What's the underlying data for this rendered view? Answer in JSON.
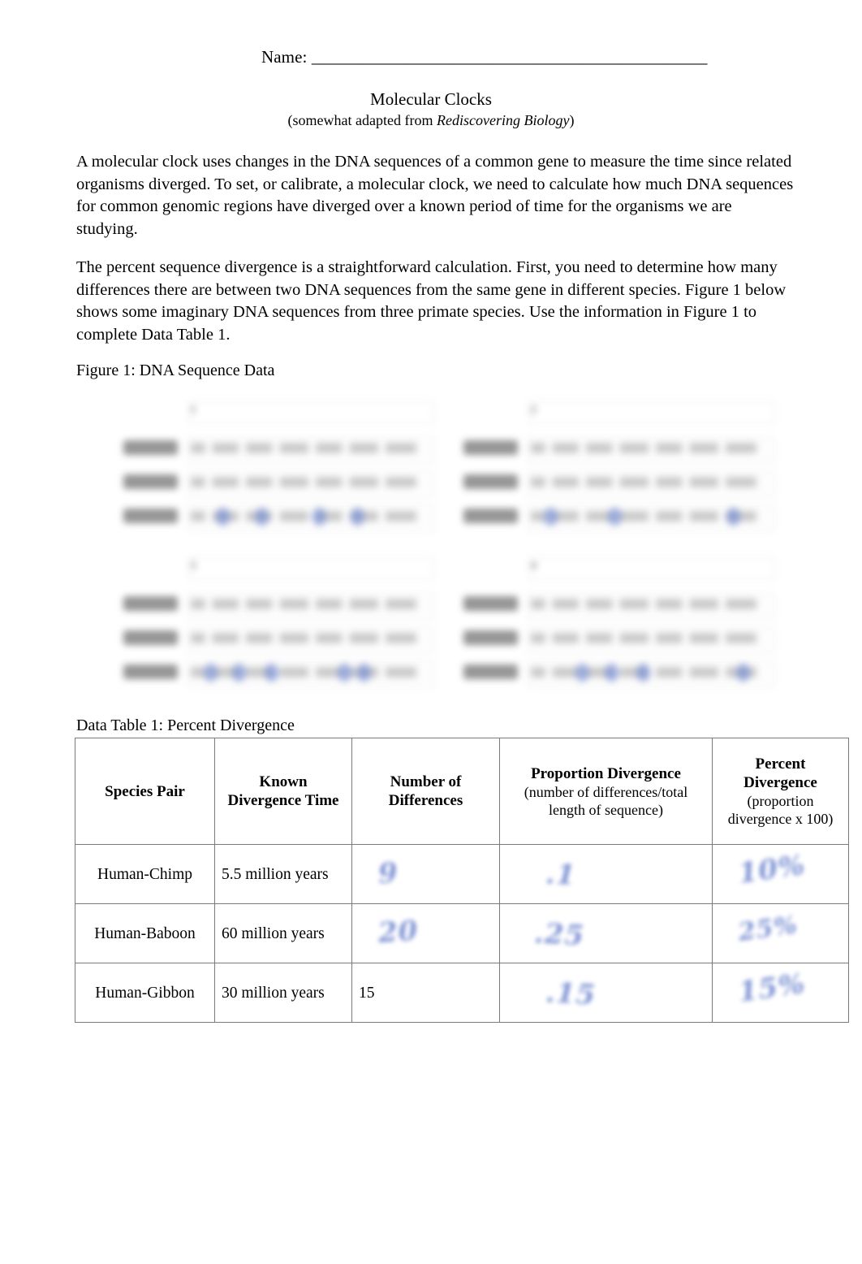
{
  "document": {
    "name_label": "Name: ______________________________________________",
    "title": "Molecular Clocks",
    "subtitle_prefix": "(somewhat adapted from ",
    "subtitle_source": "Rediscovering Biology",
    "subtitle_suffix": ")",
    "paragraph_1": "A molecular clock uses changes in the DNA sequences of a common gene to measure the time since related organisms diverged. To set, or calibrate, a molecular clock, we need to calculate how much DNA sequences for common genomic regions have diverged over a known period of time for the organisms we are studying.",
    "paragraph_2": "The percent sequence divergence is a straightforward calculation. First, you need to determine how many differences there are between two DNA sequences from the same gene in different species. Figure 1 below shows some imaginary DNA sequences from three primate species. Use the information in Figure 1 to complete Data Table 1."
  },
  "figure": {
    "caption": "Figure 1: DNA Sequence Data",
    "blocks": [
      {
        "tag": "1",
        "species": [
          "Human",
          "Chimp",
          "Baboon"
        ]
      },
      {
        "tag": "2",
        "species": [
          "Human",
          "Chimp",
          "Baboon"
        ]
      },
      {
        "tag": "3",
        "species": [
          "Human",
          "Chimp",
          "Baboon"
        ]
      },
      {
        "tag": "4",
        "species": [
          "Human",
          "Chimp",
          "Baboon"
        ]
      }
    ],
    "ink_color": "#6f86cf"
  },
  "data_table": {
    "caption": "Data Table 1: Percent Divergence",
    "headers": [
      {
        "main": "Species Pair",
        "sub": ""
      },
      {
        "main": "Known Divergence Time",
        "sub": ""
      },
      {
        "main": "Number of Differences",
        "sub": ""
      },
      {
        "main": "Proportion Divergence",
        "sub": "(number of differences/total length of sequence)"
      },
      {
        "main": "Percent Divergence",
        "sub": "(proportion divergence x 100)"
      }
    ],
    "rows": [
      {
        "species_pair": "Human-Chimp",
        "known_divergence_time": "5.5 million years",
        "number_of_differences": "9",
        "number_of_differences_printed": "",
        "proportion_divergence": ".1",
        "percent_divergence": "10%"
      },
      {
        "species_pair": "Human-Baboon",
        "known_divergence_time": "60 million years",
        "number_of_differences": "20",
        "number_of_differences_printed": "",
        "proportion_divergence": ".25",
        "percent_divergence": "25%"
      },
      {
        "species_pair": "Human-Gibbon",
        "known_divergence_time": "30  million years",
        "number_of_differences": "",
        "number_of_differences_printed": "15",
        "proportion_divergence": ".15",
        "percent_divergence": "15%"
      }
    ]
  }
}
